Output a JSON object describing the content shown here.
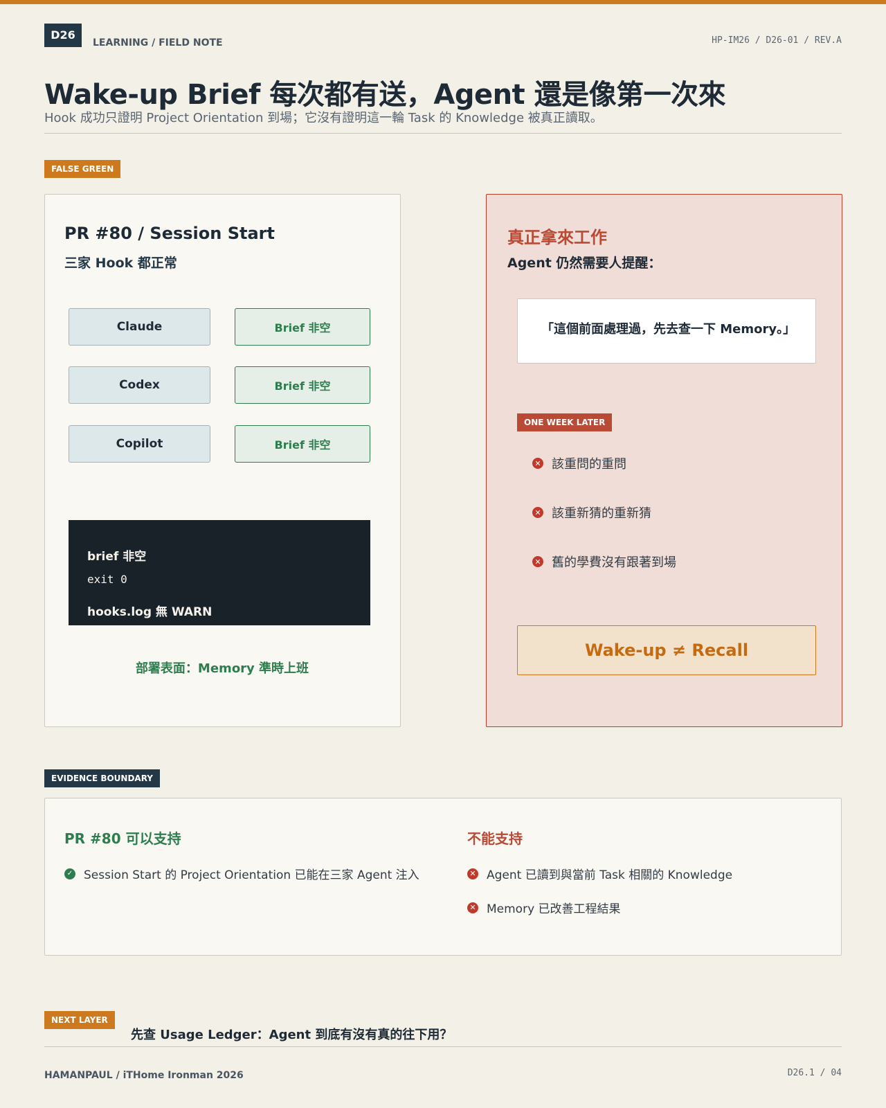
{
  "header": {
    "doc_code": "D26",
    "kicker": "LEARNING / FIELD NOTE",
    "doc_ref": "HP-IM26 / D26-01 / REV.A",
    "title": "Wake-up Brief 每次都有送，Agent 還是像第一次來",
    "subtitle": "Hook 成功只證明 Project Orientation 到場；它沒有證明這一輪 Task 的 Knowledge 被真正讀取。"
  },
  "false_green": {
    "tag": "FALSE GREEN",
    "left_panel": {
      "title": "PR #80 / Session Start",
      "subtitle": "三家 Hook 都正常",
      "rows": [
        {
          "agent": "Claude",
          "status": "Brief 非空"
        },
        {
          "agent": "Codex",
          "status": "Brief 非空"
        },
        {
          "agent": "Copilot",
          "status": "Brief 非空"
        }
      ],
      "terminal": [
        "brief 非空",
        "exit 0",
        "hooks.log 無 WARN"
      ],
      "caption": "部署表面：Memory 準時上班"
    },
    "right_panel": {
      "title": "真正拿來工作",
      "subtitle": "Agent 仍然需要人提醒：",
      "quote": "「這個前面處理過，先去查一下 Memory。」",
      "later_tag": "ONE WEEK LATER",
      "issues": [
        "該重問的重問",
        "該重新猜的重新猜",
        "舊的學費沒有跟著到場"
      ],
      "callout": "Wake-up ≠ Recall"
    }
  },
  "evidence": {
    "tag": "EVIDENCE BOUNDARY",
    "supports_title": "PR #80 可以支持",
    "supports": [
      "Session Start 的 Project Orientation 已能在三家 Agent 注入"
    ],
    "not_supports_title": "不能支持",
    "not_supports": [
      "Agent 已讀到與當前 Task 相關的 Knowledge",
      "Memory 已改善工程結果"
    ]
  },
  "next": {
    "tag": "NEXT LAYER",
    "text": "先查 Usage Ledger：Agent 到底有沒有真的往下用？"
  },
  "footer": {
    "left": "HAMANPAUL / iTHome Ironman 2026",
    "right": "D26.1 / 04"
  },
  "colors": {
    "accent": "#cd7a1f",
    "navy": "#243746",
    "green": "#2e7d4f",
    "red": "#c0392b"
  }
}
